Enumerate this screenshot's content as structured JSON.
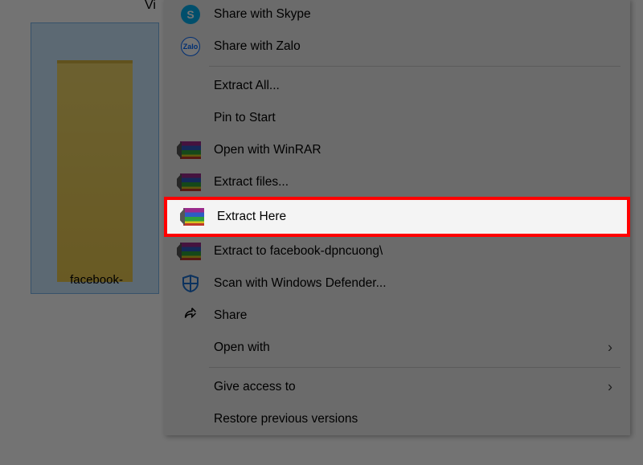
{
  "background": {
    "partial_header": "Vi",
    "file_label": "facebook-"
  },
  "menu": {
    "share_skype": "Share with Skype",
    "share_zalo": "Share with Zalo",
    "extract_all": "Extract All...",
    "pin_to_start": "Pin to Start",
    "open_winrar": "Open with WinRAR",
    "extract_files": "Extract files...",
    "extract_here": "Extract Here",
    "extract_to": "Extract to facebook-dpncuong\\",
    "defender": "Scan with Windows Defender...",
    "share": "Share",
    "open_with": "Open with",
    "give_access": "Give access to",
    "restore_prev": "Restore previous versions"
  },
  "icons": {
    "skype": "S",
    "zalo": "Zalo"
  }
}
